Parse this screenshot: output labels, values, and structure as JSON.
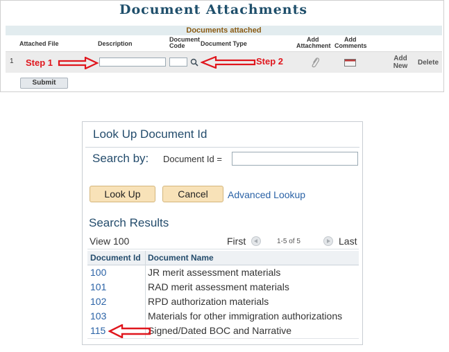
{
  "page": {
    "title": "Document Attachments"
  },
  "grid": {
    "title": "Documents attached",
    "headers": {
      "attached_file": "Attached File",
      "description": "Description",
      "document_code_1": "Document",
      "document_code_2": "Code",
      "document_type": "Document Type",
      "add_attachment_1": "Add",
      "add_attachment_2": "Attachment",
      "add_comments_1": "Add",
      "add_comments_2": "Comments"
    },
    "row": {
      "number": "1",
      "add_new_1": "Add",
      "add_new_2": "New",
      "delete": "Delete"
    },
    "submit": "Submit"
  },
  "annotations": {
    "step1": "Step 1",
    "step2": "Step 2",
    "arrow_color": "#e0161d"
  },
  "lookup": {
    "title": "Look Up Document Id",
    "search_by": "Search by:",
    "field_label": "Document Id =",
    "field_value": "",
    "lookup_button": "Look Up",
    "cancel_button": "Cancel",
    "advanced_link": "Advanced Lookup",
    "results_title": "Search Results",
    "view_all": "View 100",
    "first": "First",
    "range": "1-5 of 5",
    "last": "Last",
    "columns": {
      "id": "Document Id",
      "name": "Document Name"
    },
    "rows": [
      {
        "id": "100",
        "name": "JR merit assessment materials"
      },
      {
        "id": "101",
        "name": "RAD merit assessment materials"
      },
      {
        "id": "102",
        "name": "RPD authorization materials"
      },
      {
        "id": "103",
        "name": "Materials for other immigration authorizations"
      },
      {
        "id": "115",
        "name": "Signed/Dated BOC and Narrative"
      }
    ]
  },
  "colors": {
    "accent_blue": "#244c6c",
    "link_blue": "#2a62a6",
    "button_fill": "#f8e2b8",
    "grid_title": "#8a5a12"
  }
}
